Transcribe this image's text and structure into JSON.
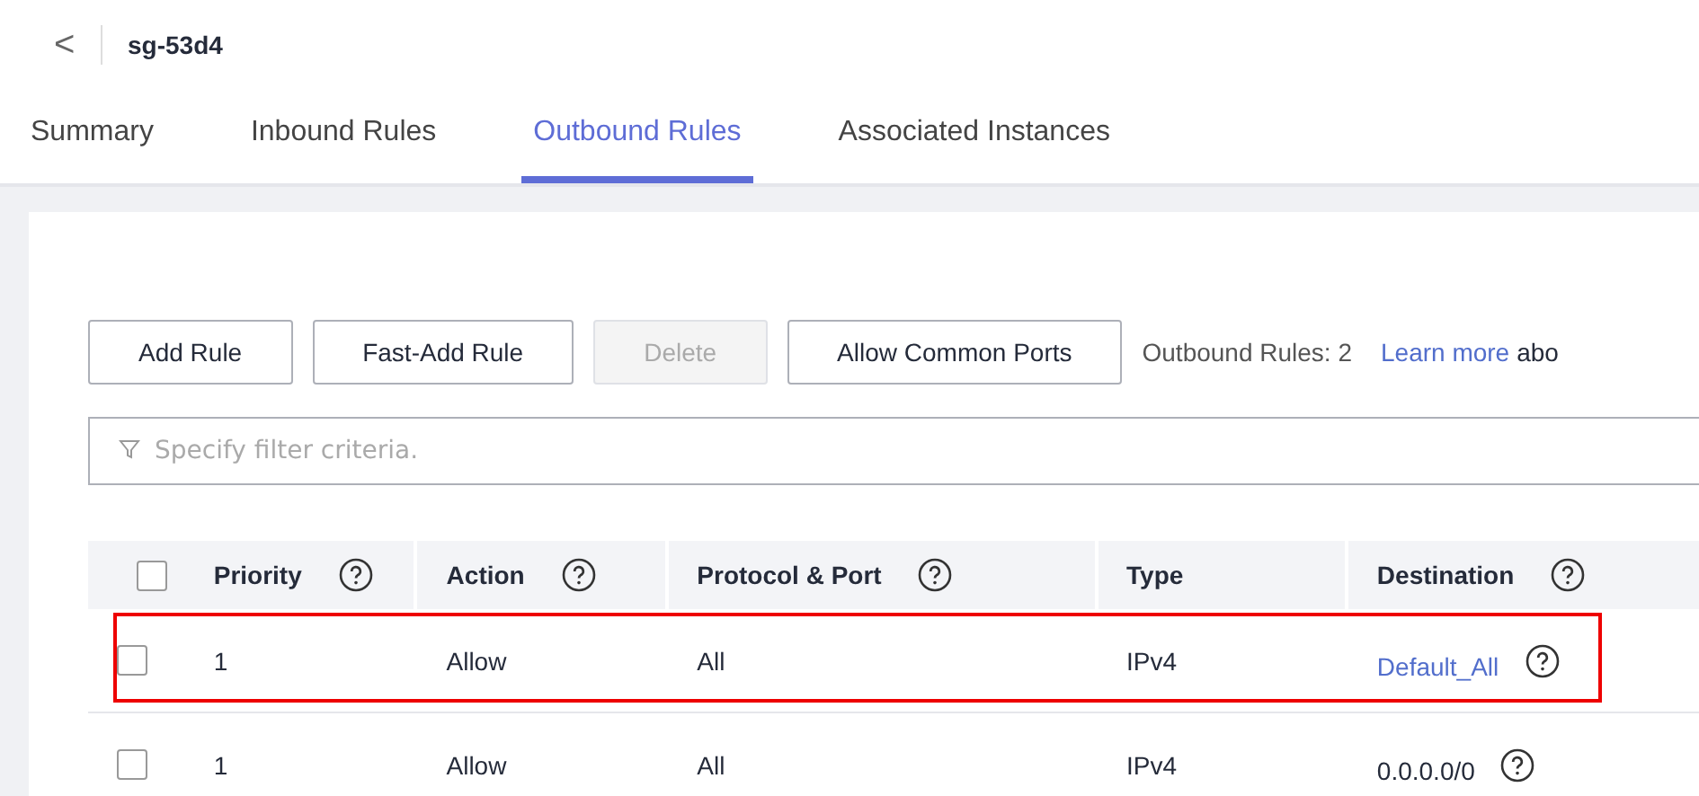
{
  "header": {
    "back": "<",
    "title": "sg-53d4"
  },
  "tabs": [
    {
      "label": "Summary",
      "selected": false
    },
    {
      "label": "Inbound Rules",
      "selected": false
    },
    {
      "label": "Outbound Rules",
      "selected": true
    },
    {
      "label": "Associated Instances",
      "selected": false
    }
  ],
  "toolbar": {
    "buttons": [
      {
        "label": "Add Rule",
        "disabled": false
      },
      {
        "label": "Fast-Add Rule",
        "disabled": false
      },
      {
        "label": "Delete",
        "disabled": true
      },
      {
        "label": "Allow Common Ports",
        "disabled": false
      }
    ],
    "count": "Outbound Rules: 2",
    "link": "Learn more",
    "after_link": "abo"
  },
  "filter": {
    "placeholder": "Specify filter criteria."
  },
  "table": {
    "select_all": {
      "checked": false
    },
    "columns": [
      {
        "label": "Priority",
        "help": true
      },
      {
        "label": "Action",
        "help": true
      },
      {
        "label": "Protocol & Port",
        "help": true
      },
      {
        "label": "Type",
        "help": false
      },
      {
        "label": "Destination",
        "help": true
      }
    ],
    "rows": [
      {
        "checked": false,
        "highlighted": true,
        "priority": "1",
        "action": "Allow",
        "protocol": "All",
        "type": "IPv4",
        "destination": {
          "kind": "link",
          "text": "Default_All"
        }
      },
      {
        "checked": false,
        "highlighted": false,
        "priority": "1",
        "action": "Allow",
        "protocol": "All",
        "type": "IPv4",
        "destination": {
          "kind": "text",
          "text": "0.0.0.0/0"
        }
      }
    ]
  }
}
